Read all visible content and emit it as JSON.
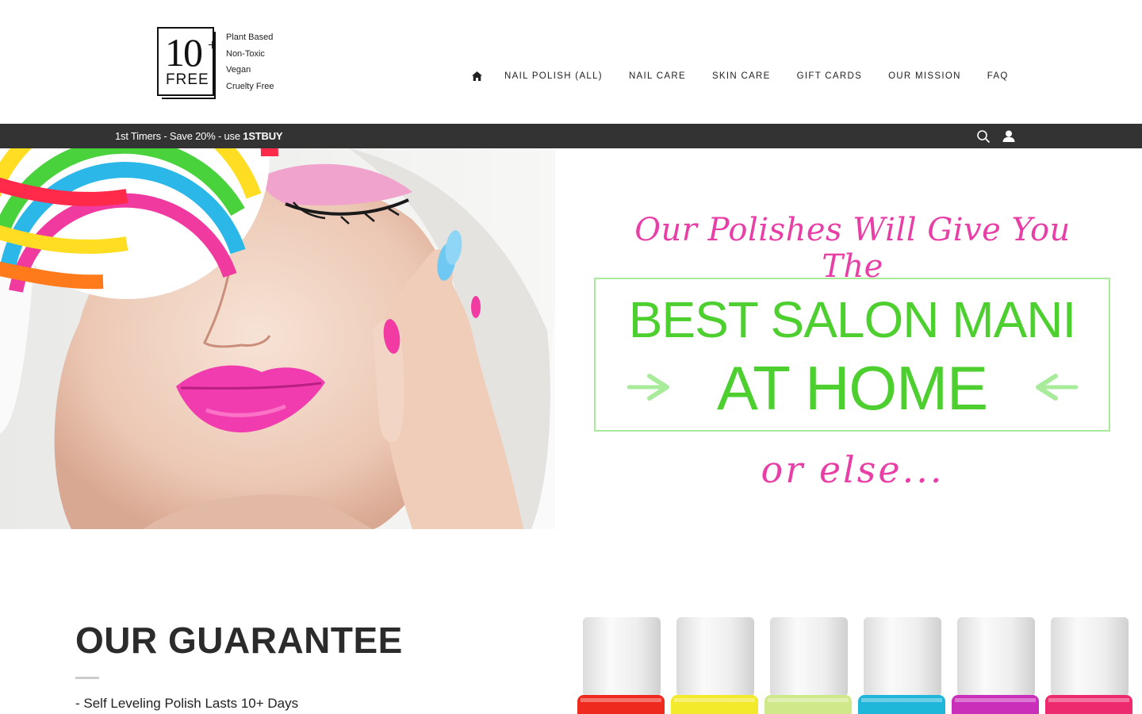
{
  "header": {
    "logo": {
      "number": "10",
      "plus": "+",
      "word": "FREE",
      "tags": [
        "Plant Based",
        "Non-Toxic",
        "Vegan",
        "Cruelty Free"
      ]
    },
    "nav": {
      "home_icon": "home-icon",
      "items": [
        "NAIL POLISH (ALL)",
        "NAIL CARE",
        "SKIN CARE",
        "GIFT CARDS",
        "OUR MISSION",
        "FAQ"
      ]
    }
  },
  "promo": {
    "text": "1st Timers - Save 20% - use ",
    "code": "1STBUY",
    "search_icon": "search-icon",
    "account_icon": "user-icon"
  },
  "hero": {
    "line_top": "Our Polishes Will Give You The",
    "box_line1": "BEST SALON MANI",
    "box_line2": "AT HOME",
    "line_bottom": "or else...",
    "colors": {
      "pink": "#e83fa7",
      "green": "#4ccf2f",
      "green_light": "#a8ec9b"
    }
  },
  "guarantee": {
    "title": "OUR GUARANTEE",
    "items": [
      "- Self Leveling Polish Lasts 10+ Days"
    ]
  },
  "bottles": {
    "colors": [
      "#ee2a1e",
      "#f2ea2a",
      "#cfe88a",
      "#1fb6d9",
      "#c92fb8",
      "#ee2a6e"
    ]
  }
}
